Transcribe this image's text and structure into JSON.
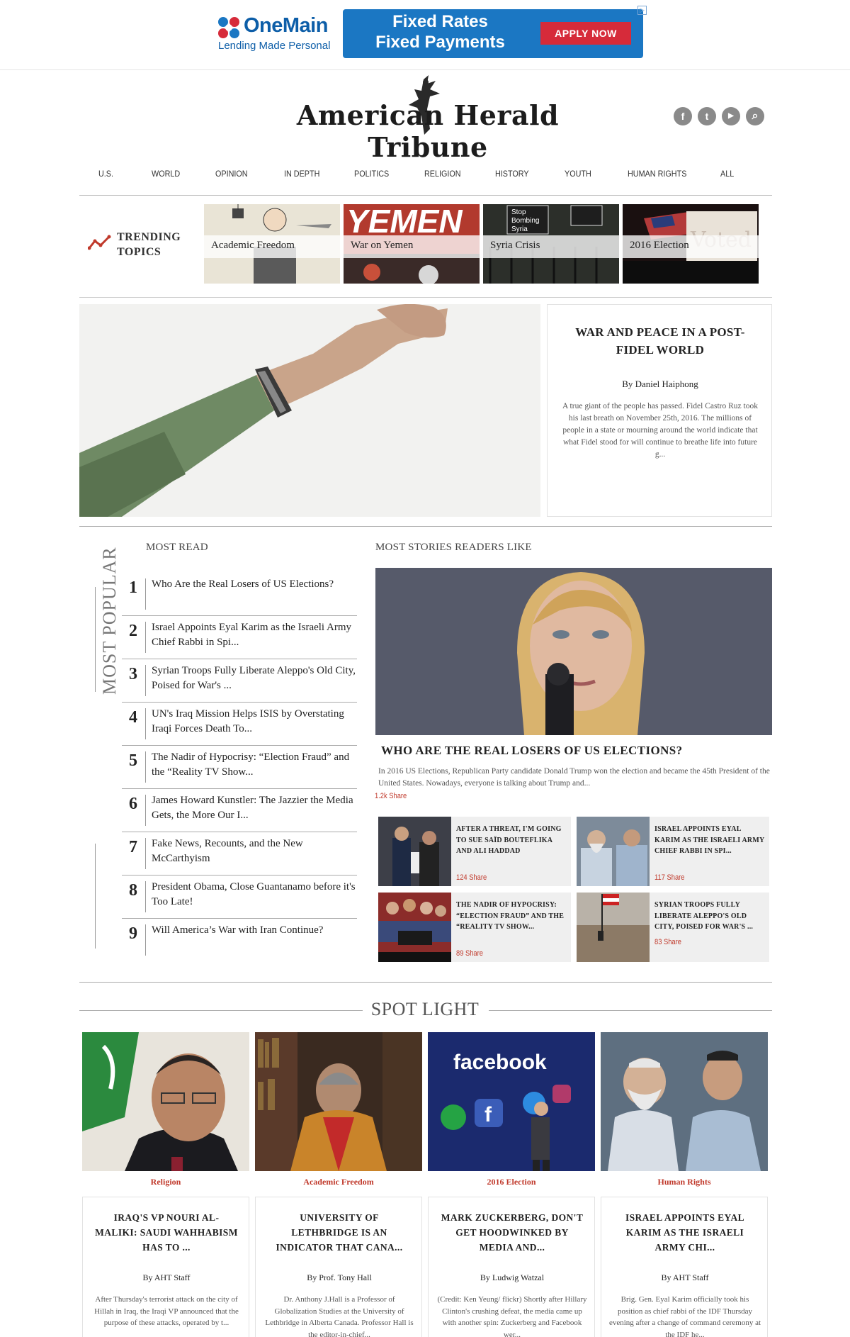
{
  "ad": {
    "brand": "OneMain",
    "tagline": "Lending Made Personal",
    "headline_1": "Fixed Rates",
    "headline_2": "Fixed Payments",
    "cta": "APPLY NOW",
    "choices": "▷",
    "colors": {
      "brand_blue": "#0d5ea8",
      "banner_blue": "#1b77c3",
      "cta_red": "#d62b3a"
    }
  },
  "site": {
    "name": "American Herald Tribune",
    "social": [
      "facebook-icon",
      "twitter-icon",
      "youtube-icon",
      "search-icon"
    ],
    "social_glyphs": [
      "f",
      "t",
      "▶",
      "⌕"
    ]
  },
  "nav": {
    "items": [
      "U.S.",
      "WORLD",
      "OPINION",
      "IN DEPTH",
      "POLITICS",
      "RELIGION",
      "HISTORY",
      "YOUTH",
      "HUMAN RIGHTS",
      "ALL"
    ]
  },
  "trending": {
    "label_1": "TRENDING",
    "label_2": "TOPICS",
    "icon": "trend-line-icon",
    "topics": [
      "Academic Freedom",
      "War on Yemen",
      "Syria Crisis",
      "2016 Election"
    ]
  },
  "feature": {
    "title": "WAR AND PEACE IN A POST-FIDEL WORLD",
    "by_prefix": "By",
    "author": "Daniel Haiphong",
    "excerpt": "A true giant of the people has passed. Fidel Castro Ruz took his last breath on November 25th, 2016. The millions of people in a state or mourning around the world indicate that what Fidel stood for will continue to breathe life into future g..."
  },
  "most_read": {
    "heading": "MOST READ",
    "vertical_label": "MOST POPULAR",
    "items": [
      {
        "num": "1",
        "title": "Who Are the Real Losers of US Elections?"
      },
      {
        "num": "2",
        "title": "Israel Appoints Eyal Karim as the Israeli Army Chief Rabbi in Spi..."
      },
      {
        "num": "3",
        "title": "Syrian Troops Fully Liberate Aleppo's Old City, Poised for War's ..."
      },
      {
        "num": "4",
        "title": "UN's Iraq Mission Helps ISIS by Overstating Iraqi Forces Death To..."
      },
      {
        "num": "5",
        "title": "The Nadir of Hypocrisy: “Election Fraud” and the “Reality TV Show..."
      },
      {
        "num": "6",
        "title": "James Howard Kunstler: The Jazzier the Media Gets, the More Our I..."
      },
      {
        "num": "7",
        "title": "Fake News, Recounts, and the New McCarthyism"
      },
      {
        "num": "8",
        "title": "President Obama, Close Guantanamo before it's Too Late!"
      },
      {
        "num": "9",
        "title": "Will America’s War with Iran Continue?"
      }
    ]
  },
  "readers_like": {
    "heading": "MOST STORIES READERS LIKE",
    "lead": {
      "title": "WHO ARE THE REAL LOSERS OF US ELECTIONS?",
      "excerpt": "In 2016 US Elections, Republican Party candidate Donald Trump won the election and became the 45th President of the United States.  Nowadays, everyone is talking about Trump and...",
      "share": "1.2k Share"
    },
    "minis": [
      {
        "title": "AFTER A THREAT, I'M GOING TO SUE SAÏD BOUTEFLIKA AND ALI HADDAD",
        "share": "124 Share"
      },
      {
        "title": "ISRAEL APPOINTS EYAL KARIM AS THE ISRAELI ARMY CHIEF RABBI IN SPI...",
        "share": "117 Share"
      },
      {
        "title": "THE NADIR OF HYPOCRISY: “ELECTION FRAUD” AND THE “REALITY TV SHOW...",
        "share": "89 Share"
      },
      {
        "title": "SYRIAN TROOPS FULLY LIBERATE ALEPPO'S OLD CITY, POISED FOR WAR'S ...",
        "share": "83 Share"
      }
    ]
  },
  "spotlight": {
    "heading": "SPOT LIGHT",
    "items": [
      {
        "category": "Religion",
        "title": "IRAQ'S VP NOURI AL-MALIKI: SAUDI WAHHABISM HAS TO ...",
        "by_prefix": "By",
        "author": "AHT Staff",
        "excerpt": "After Thursday's terrorist attack on the city of Hillah in Iraq, the Iraqi VP announced that the purpose of these attacks, operated by t..."
      },
      {
        "category": "Academic Freedom",
        "title": "UNIVERSITY OF LETHBRIDGE IS AN INDICATOR THAT CANA...",
        "by_prefix": "By",
        "author": "Prof. Tony Hall",
        "excerpt": "Dr. Anthony J.Hall is a Professor of Globalization Studies at the University of Lethbridge in Alberta Canada. Professor Hall is the editor-in-chief..."
      },
      {
        "category": "2016 Election",
        "title": "MARK ZUCKERBERG, DON'T GET HOODWINKED BY MEDIA AND...",
        "by_prefix": "By",
        "author": "Ludwig Watzal",
        "excerpt": "(Credit: Ken Yeung/ flickr) Shortly after Hillary Clinton's crushing defeat, the media came up with another spin: Zuckerberg and Facebook wer..."
      },
      {
        "category": "Human Rights",
        "title": "ISRAEL APPOINTS EYAL KARIM AS THE ISRAELI ARMY CHI...",
        "by_prefix": "By",
        "author": "AHT Staff",
        "excerpt": "Brig. Gen. Eyal Karim officially took his position as chief rabbi of the IDF Thursday evening after a change of command ceremony at the IDF he..."
      }
    ]
  },
  "colors": {
    "accent_red": "#c0392b",
    "rule_gray": "#aaaaaa"
  }
}
